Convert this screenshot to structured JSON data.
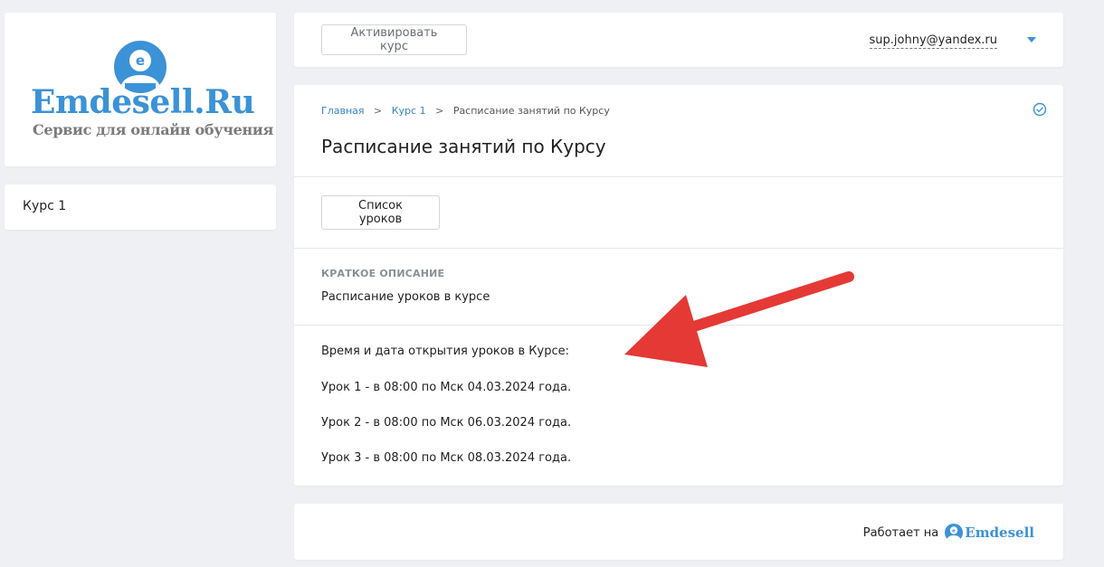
{
  "logo": {
    "title": "Emdesell.Ru",
    "subtitle": "Сервис для онлайн обучения"
  },
  "sidebar": {
    "items": [
      {
        "label": "Курс 1"
      }
    ]
  },
  "topbar": {
    "activate_label": "Активировать курс",
    "user_email": "sup.johny@yandex.ru"
  },
  "breadcrumb": {
    "items": [
      {
        "label": "Главная"
      },
      {
        "label": "Курс 1"
      },
      {
        "label": "Расписание занятий по Курсу"
      }
    ],
    "separator": ">"
  },
  "page": {
    "title": "Расписание занятий по Курсу",
    "lessons_button": "Список уроков",
    "description_label": "КРАТКОЕ ОПИСАНИЕ",
    "description_text": "Расписание уроков в курсе",
    "schedule": [
      "Время и дата открытия уроков в Курсе:",
      "Урок 1 - в 08:00 по Мск 04.03.2024 года.",
      "Урок 2 - в 08:00 по Мск 06.03.2024 года.",
      "Урок 3 - в 08:00 по Мск 08.03.2024 года."
    ]
  },
  "footer": {
    "powered_text": "Работает на",
    "brand": "Emdesell"
  },
  "colors": {
    "accent": "#3b92d6",
    "link": "#3b82c4",
    "arrow": "#e53935",
    "background": "#eff0f3"
  },
  "icons": [
    "emdesell-logo-icon",
    "chevron-down-icon",
    "check-circle-icon",
    "arrow-annotation"
  ]
}
